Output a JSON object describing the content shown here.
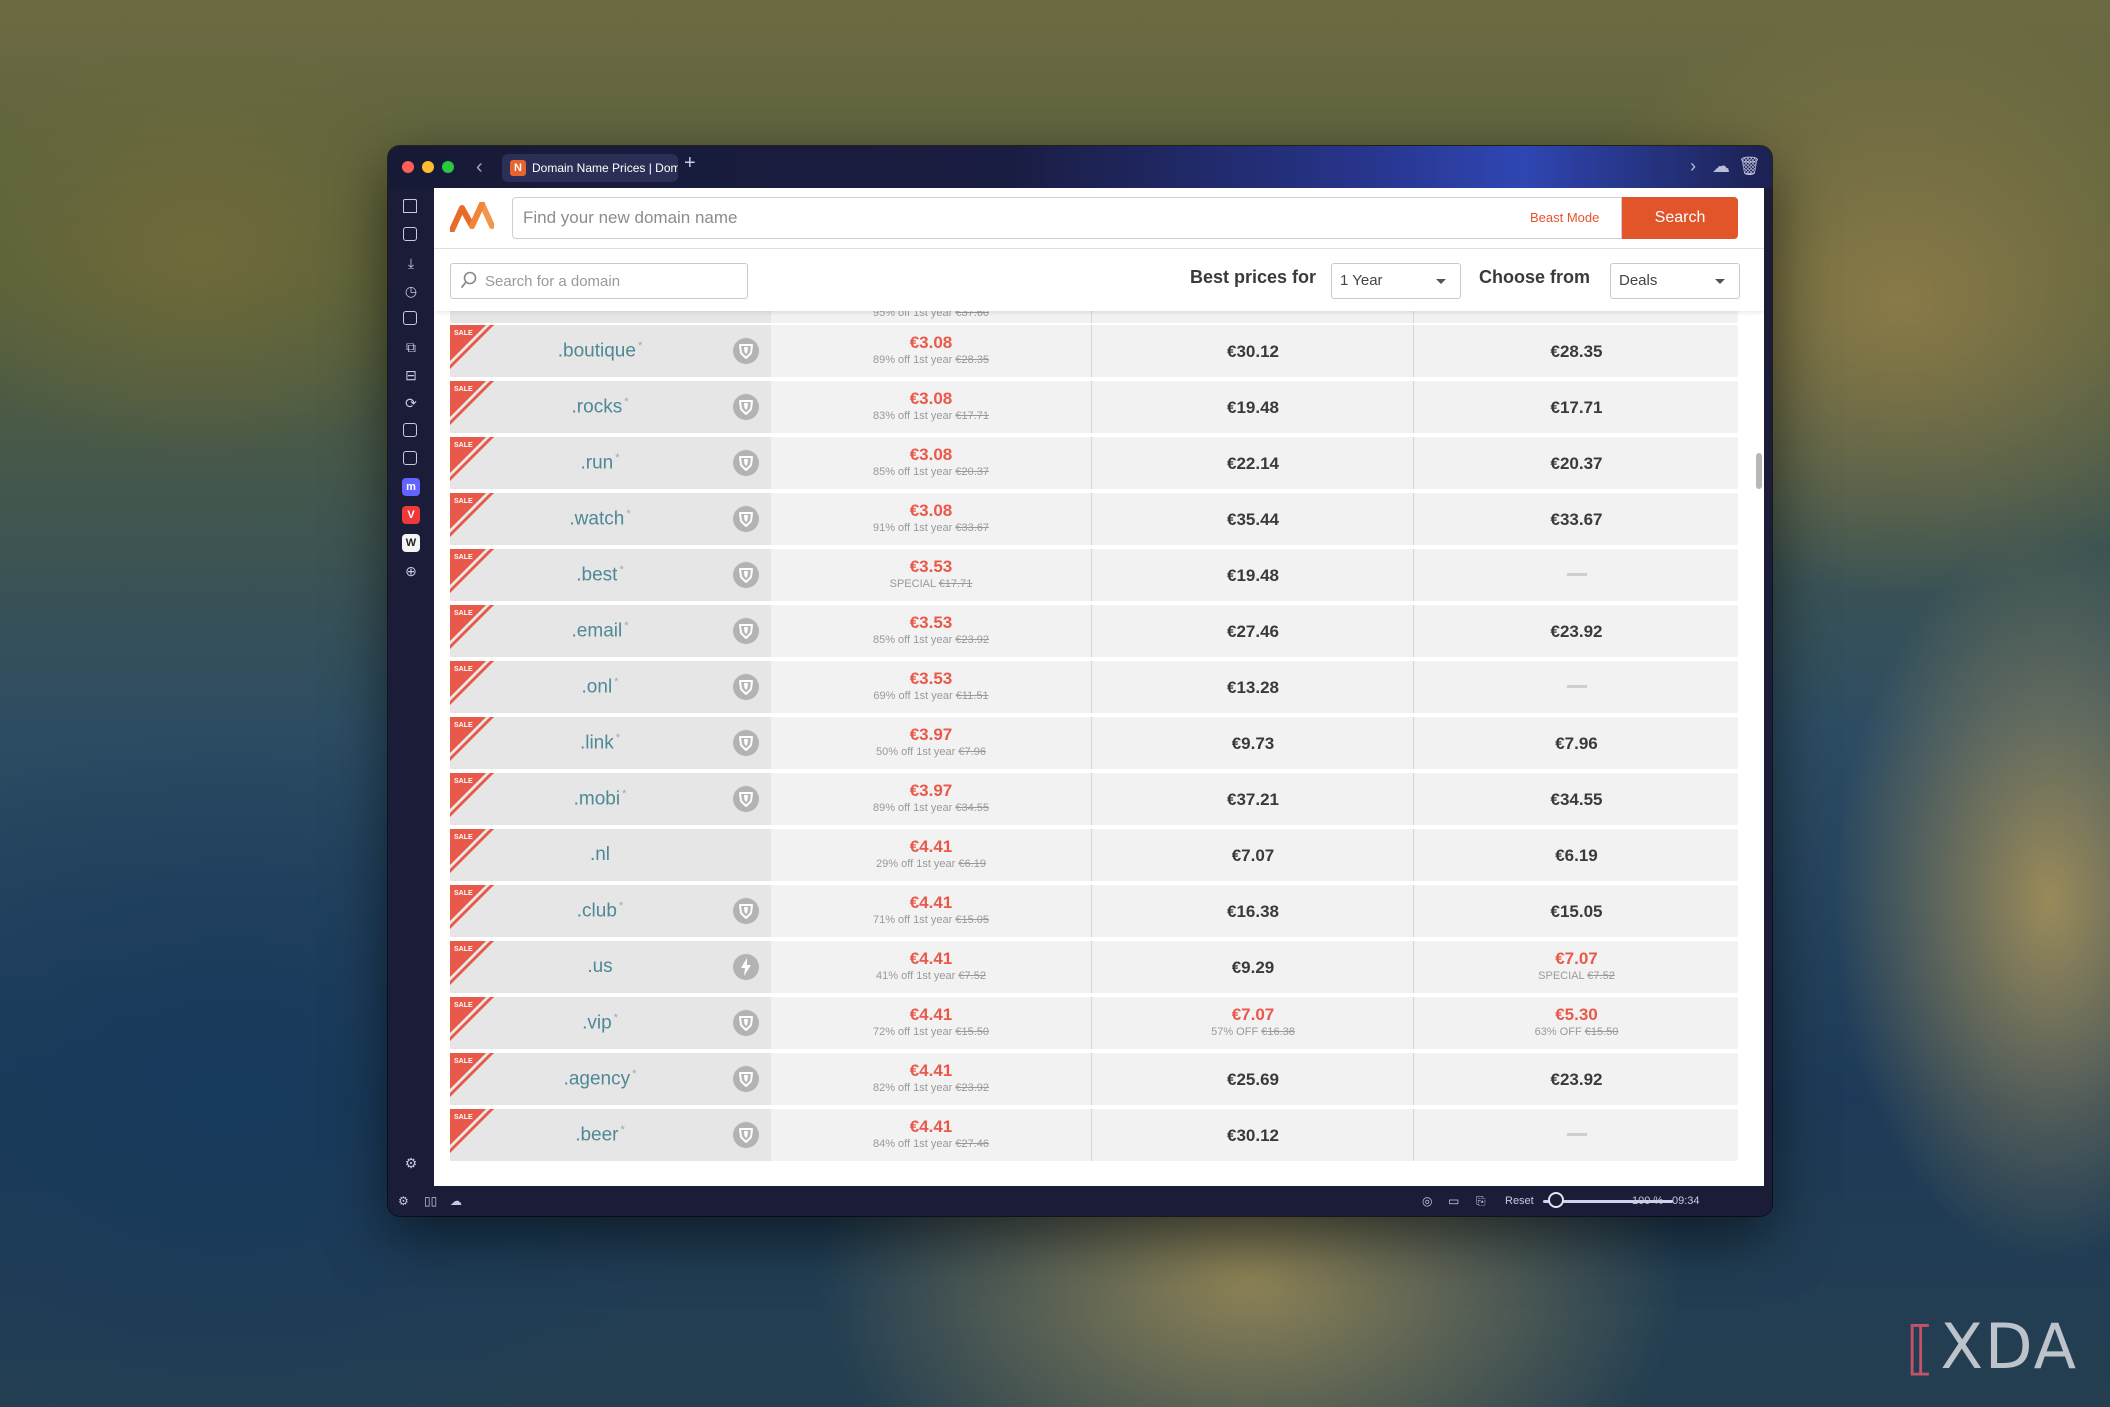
{
  "browser": {
    "tab_title": "Domain Name Prices | Dom",
    "tab_favicon": "N",
    "zoom_reset_label": "Reset",
    "zoom_level": "100 %",
    "clock": "09:34"
  },
  "header": {
    "search_placeholder": "Find your new domain name",
    "beast_mode": "Beast Mode",
    "search_button": "Search",
    "brand_color": "#e2552b"
  },
  "filters": {
    "domain_search_placeholder": "Search for a domain",
    "best_prices_label": "Best prices for",
    "period_value": "1 Year",
    "choose_from_label": "Choose from",
    "category_value": "Deals"
  },
  "table": {
    "sale_badge": "SALE",
    "partial_row": {
      "sub": "95% off 1st year",
      "old": "€37.60"
    },
    "rows": [
      {
        "tld": ".boutique",
        "star": "*",
        "icon": "shield",
        "reg_price": "€3.08",
        "reg_note": "89% off 1st year",
        "reg_old": "€28.35",
        "renew": "€30.12",
        "renew_note": "",
        "renew_old": "",
        "transfer": "€28.35",
        "transfer_note": "",
        "transfer_old": ""
      },
      {
        "tld": ".rocks",
        "star": "*",
        "icon": "shield",
        "reg_price": "€3.08",
        "reg_note": "83% off 1st year",
        "reg_old": "€17.71",
        "renew": "€19.48",
        "renew_note": "",
        "renew_old": "",
        "transfer": "€17.71",
        "transfer_note": "",
        "transfer_old": ""
      },
      {
        "tld": ".run",
        "star": "*",
        "icon": "shield",
        "reg_price": "€3.08",
        "reg_note": "85% off 1st year",
        "reg_old": "€20.37",
        "renew": "€22.14",
        "renew_note": "",
        "renew_old": "",
        "transfer": "€20.37",
        "transfer_note": "",
        "transfer_old": ""
      },
      {
        "tld": ".watch",
        "star": "*",
        "icon": "shield",
        "reg_price": "€3.08",
        "reg_note": "91% off 1st year",
        "reg_old": "€33.67",
        "renew": "€35.44",
        "renew_note": "",
        "renew_old": "",
        "transfer": "€33.67",
        "transfer_note": "",
        "transfer_old": ""
      },
      {
        "tld": ".best",
        "star": "*",
        "icon": "shield",
        "reg_price": "€3.53",
        "reg_note": "SPECIAL",
        "reg_old": "€17.71",
        "renew": "€19.48",
        "renew_note": "",
        "renew_old": "",
        "transfer": "",
        "transfer_note": "",
        "transfer_old": ""
      },
      {
        "tld": ".email",
        "star": "*",
        "icon": "shield",
        "reg_price": "€3.53",
        "reg_note": "85% off 1st year",
        "reg_old": "€23.92",
        "renew": "€27.46",
        "renew_note": "",
        "renew_old": "",
        "transfer": "€23.92",
        "transfer_note": "",
        "transfer_old": ""
      },
      {
        "tld": ".onl",
        "star": "*",
        "icon": "shield",
        "reg_price": "€3.53",
        "reg_note": "69% off 1st year",
        "reg_old": "€11.51",
        "renew": "€13.28",
        "renew_note": "",
        "renew_old": "",
        "transfer": "",
        "transfer_note": "",
        "transfer_old": ""
      },
      {
        "tld": ".link",
        "star": "*",
        "icon": "shield",
        "reg_price": "€3.97",
        "reg_note": "50% off 1st year",
        "reg_old": "€7.96",
        "renew": "€9.73",
        "renew_note": "",
        "renew_old": "",
        "transfer": "€7.96",
        "transfer_note": "",
        "transfer_old": ""
      },
      {
        "tld": ".mobi",
        "star": "*",
        "icon": "shield",
        "reg_price": "€3.97",
        "reg_note": "89% off 1st year",
        "reg_old": "€34.55",
        "renew": "€37.21",
        "renew_note": "",
        "renew_old": "",
        "transfer": "€34.55",
        "transfer_note": "",
        "transfer_old": ""
      },
      {
        "tld": ".nl",
        "star": "",
        "icon": "",
        "reg_price": "€4.41",
        "reg_note": "29% off 1st year",
        "reg_old": "€6.19",
        "renew": "€7.07",
        "renew_note": "",
        "renew_old": "",
        "transfer": "€6.19",
        "transfer_note": "",
        "transfer_old": ""
      },
      {
        "tld": ".club",
        "star": "*",
        "icon": "shield",
        "reg_price": "€4.41",
        "reg_note": "71% off 1st year",
        "reg_old": "€15.05",
        "renew": "€16.38",
        "renew_note": "",
        "renew_old": "",
        "transfer": "€15.05",
        "transfer_note": "",
        "transfer_old": ""
      },
      {
        "tld": ".us",
        "star": "",
        "icon": "bolt",
        "reg_price": "€4.41",
        "reg_note": "41% off 1st year",
        "reg_old": "€7.52",
        "renew": "€9.29",
        "renew_note": "",
        "renew_old": "",
        "transfer": "€7.07",
        "transfer_note": "SPECIAL",
        "transfer_old": "€7.52"
      },
      {
        "tld": ".vip",
        "star": "*",
        "icon": "shield",
        "reg_price": "€4.41",
        "reg_note": "72% off 1st year",
        "reg_old": "€15.50",
        "renew": "€7.07",
        "renew_note": "57% OFF",
        "renew_old": "€16.38",
        "transfer": "€5.30",
        "transfer_note": "63% OFF",
        "transfer_old": "€15.50"
      },
      {
        "tld": ".agency",
        "star": "*",
        "icon": "shield",
        "reg_price": "€4.41",
        "reg_note": "82% off 1st year",
        "reg_old": "€23.92",
        "renew": "€25.69",
        "renew_note": "",
        "renew_old": "",
        "transfer": "€23.92",
        "transfer_note": "",
        "transfer_old": ""
      },
      {
        "tld": ".beer",
        "star": "*",
        "icon": "shield",
        "reg_price": "€4.41",
        "reg_note": "84% off 1st year",
        "reg_old": "€27.46",
        "renew": "€30.12",
        "renew_note": "",
        "renew_old": "",
        "transfer": "",
        "transfer_note": "",
        "transfer_old": ""
      }
    ]
  },
  "watermark": "XDA"
}
